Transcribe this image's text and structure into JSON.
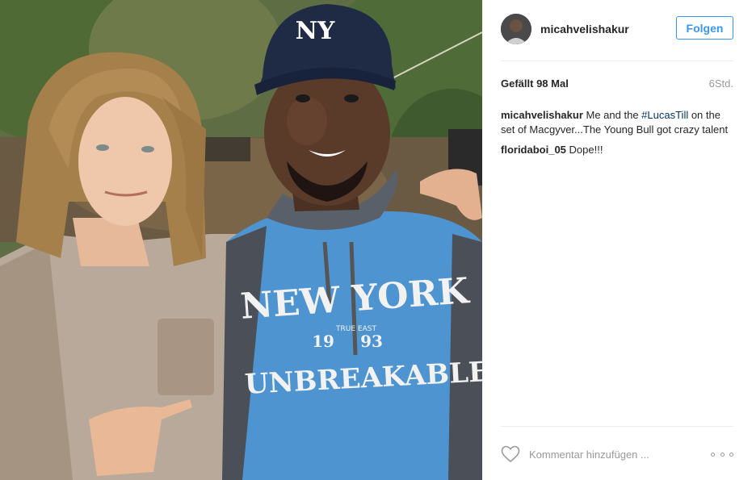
{
  "post": {
    "username": "micahvelishakur",
    "follow_label": "Folgen",
    "likes": "Gefällt 98 Mal",
    "time": "6Std.",
    "comments": [
      {
        "user": "micahvelishakur",
        "text_before": " Me and the ",
        "hashtag": "#LucasTill",
        "text_after": " on the set of Macgyver...The Young Bull got crazy talent"
      },
      {
        "user": "floridaboi_05",
        "text_before": " Dope!!!",
        "hashtag": "",
        "text_after": ""
      }
    ],
    "comment_placeholder": "Kommentar hinzufügen ...",
    "cap_logo": "NY",
    "shirt_print": [
      "NEW YORK",
      "TRUE EAST",
      "19",
      "93",
      "UNBREAKABLE"
    ]
  },
  "colors": {
    "link": "#003569",
    "follow_blue": "#3897f0",
    "text": "#262626",
    "muted": "#999999",
    "shirt": "#4e94d0",
    "cap": "#1f2a44"
  },
  "icons": {
    "heart": "heart-icon",
    "more": "more-options-icon"
  }
}
